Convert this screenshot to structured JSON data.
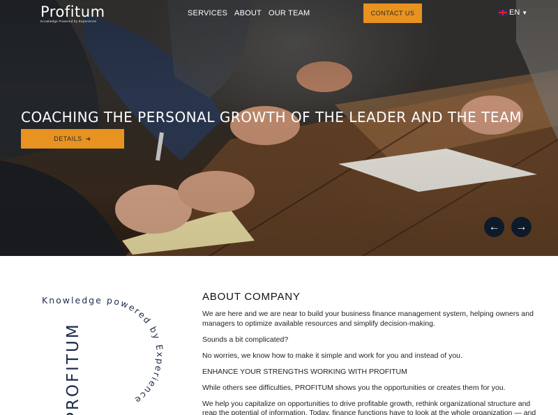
{
  "brand": {
    "name": "Profitum",
    "tagline": "Knowledge Powered by Experience"
  },
  "nav": {
    "items": [
      "SERVICES",
      "ABOUT",
      "OUR TEAM"
    ]
  },
  "header": {
    "contact_label": "CONTACT US",
    "language": "EN",
    "flag_icon": "uk-flag-icon",
    "lang_chevron_icon": "chevron-down-icon"
  },
  "hero": {
    "title": "COACHING THE PERSONAL GROWTH OF THE LEADER AND THE TEAM",
    "details_label": "DETAILS",
    "details_icon": "arrow-right-icon",
    "prev_icon": "arrow-left-icon",
    "next_icon": "arrow-right-icon"
  },
  "colors": {
    "accent": "#e8921f",
    "dark_navy": "#0d1a2a",
    "logo_navy": "#1c2b4a"
  },
  "about": {
    "emblem": {
      "arc_text": "Knowledge powered by Experience",
      "vertical_text": "PROFITUM"
    },
    "title": "ABOUT COMPANY",
    "paragraphs": [
      "We are here and we are near to build your business finance management system, helping owners and managers to optimize available resources and simplify decision-making.",
      "Sounds a bit complicated?",
      "No worries, we know how to make it simple and work for you and instead of you.",
      "ENHANCE YOUR STRENGTHS WORKING WITH PROFITUM",
      "While others see difficulties, PROFITUM shows you the opportunities or creates them for you.",
      "We help you capitalize on opportunities to drive profitable growth, rethink organizational structure and reap the potential of information. Today, finance functions have to look at the whole organization — and beyond."
    ]
  }
}
